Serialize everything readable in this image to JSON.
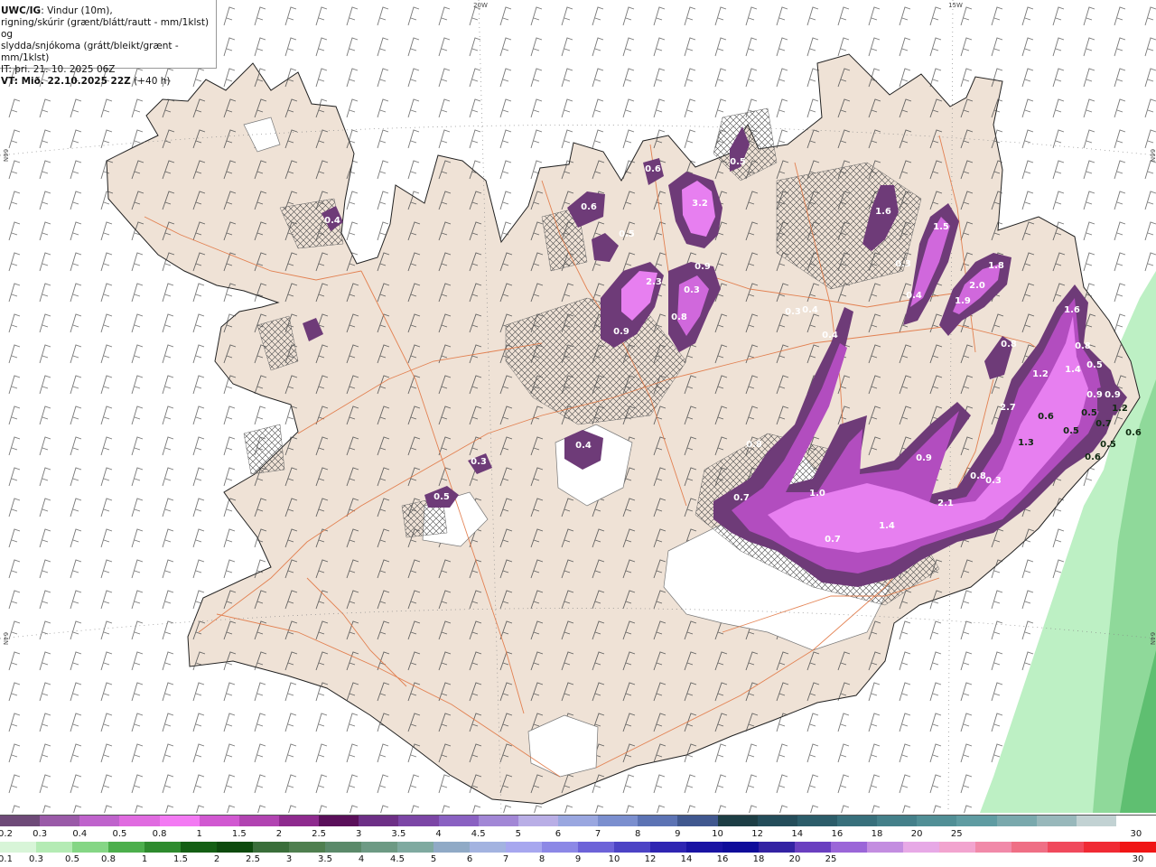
{
  "info": {
    "product": "UWC/IG",
    "line1_rest": ": Vindur (10m),",
    "line2": "rigning/skúrir (grænt/blátt/rautt - mm/1klst) og",
    "line3": "slydda/snjókoma (grátt/bleikt/grænt - mm/1klst)",
    "line4": "IT: þri. 21. 10. 2025 06Z",
    "vt_label": "VT: Mið. 22.10.2025 22Z",
    "vt_rest": " (+40 h)"
  },
  "grid_labels": {
    "top_20w": "20W",
    "top_15w": "15W",
    "left_66n": "66N",
    "left_64n": "64N",
    "right_66n": "66N",
    "right_64n": "64N"
  },
  "precip_labels": [
    {
      "text": "0.4"
    },
    {
      "text": "0.5"
    },
    {
      "text": "0.6"
    },
    {
      "text": "0.6"
    },
    {
      "text": "3.2"
    },
    {
      "text": "0.5"
    },
    {
      "text": "2.3"
    },
    {
      "text": "0.9"
    },
    {
      "text": "0.3"
    },
    {
      "text": "0.8"
    },
    {
      "text": "0.9"
    },
    {
      "text": "1.6"
    },
    {
      "text": "1.5"
    },
    {
      "text": "0.3"
    },
    {
      "text": "0.4"
    },
    {
      "text": "1.8"
    },
    {
      "text": "2.0"
    },
    {
      "text": "1.9"
    },
    {
      "text": "0.3"
    },
    {
      "text": "0.4"
    },
    {
      "text": "0.4"
    },
    {
      "text": "1.6"
    },
    {
      "text": "0.8"
    },
    {
      "text": "0.8"
    },
    {
      "text": "1.2"
    },
    {
      "text": "1.4"
    },
    {
      "text": "0.5"
    },
    {
      "text": "0.9"
    },
    {
      "text": "0.9"
    },
    {
      "text": "2.7"
    },
    {
      "text": "0.6"
    },
    {
      "text": "0.5"
    },
    {
      "text": "0.7"
    },
    {
      "text": "1.2"
    },
    {
      "text": "0.6"
    },
    {
      "text": "0.5"
    },
    {
      "text": "0.6"
    },
    {
      "text": "1.3"
    },
    {
      "text": "0.5"
    },
    {
      "text": "0.8"
    },
    {
      "text": "0.9"
    },
    {
      "text": "0.8"
    },
    {
      "text": "0.4"
    },
    {
      "text": "0.3"
    },
    {
      "text": "0.5"
    },
    {
      "text": "0.7"
    },
    {
      "text": "1.0"
    },
    {
      "text": "1.4"
    },
    {
      "text": "2.1"
    },
    {
      "text": "0.7"
    },
    {
      "text": "0.3"
    }
  ],
  "legend_snow": {
    "colors": [
      "#6e4a78",
      "#9a5aa8",
      "#bf63cc",
      "#e06be0",
      "#f37af3",
      "#d158d1",
      "#b143b1",
      "#8e2a8e",
      "#5a0f5a",
      "#6d2f86",
      "#7c46a6",
      "#8a61c2",
      "#a287d6",
      "#b9aee6",
      "#9aa7e0",
      "#7b8fcf",
      "#5c73b4",
      "#40588f",
      "#1d3e45",
      "#244d5a",
      "#2c5d6a",
      "#38707c",
      "#44808a",
      "#518f96",
      "#5f9ca2",
      "#7aa9ad",
      "#98b8bb",
      "#c2d2d3",
      "#ffffff"
    ],
    "ticks": [
      "0.2",
      "0.3",
      "0.4",
      "0.5",
      "0.8",
      "1",
      "1.5",
      "2",
      "2.5",
      "3",
      "3.5",
      "4",
      "4.5",
      "5",
      "6",
      "7",
      "8",
      "9",
      "10",
      "12",
      "14",
      "16",
      "18",
      "20",
      "25",
      "30"
    ]
  },
  "legend_rain": {
    "colors": [
      "#d8f5d8",
      "#b4ebb4",
      "#85d685",
      "#4caf4c",
      "#2e8b2e",
      "#145f14",
      "#0d4a0d",
      "#3a6e3a",
      "#4f7f4f",
      "#5b8a6a",
      "#6d9a84",
      "#7faaa0",
      "#90aac6",
      "#a3b3e0",
      "#a7a7ef",
      "#8c88e6",
      "#6d63d8",
      "#4c43c5",
      "#2f25b2",
      "#1a13a3",
      "#0f0c9a",
      "#3322a3",
      "#6a3fc0",
      "#9b66d8",
      "#c38de0",
      "#e7a9e6",
      "#f2a4cf",
      "#f18aa9",
      "#ef6f85",
      "#f0495c",
      "#f02a34",
      "#f01515"
    ],
    "ticks": [
      "0.1",
      "0.3",
      "0.5",
      "0.8",
      "1",
      "1.5",
      "2",
      "2.5",
      "3",
      "3.5",
      "4",
      "4.5",
      "5",
      "6",
      "7",
      "8",
      "9",
      "10",
      "12",
      "14",
      "16",
      "18",
      "20",
      "25",
      "30"
    ]
  }
}
